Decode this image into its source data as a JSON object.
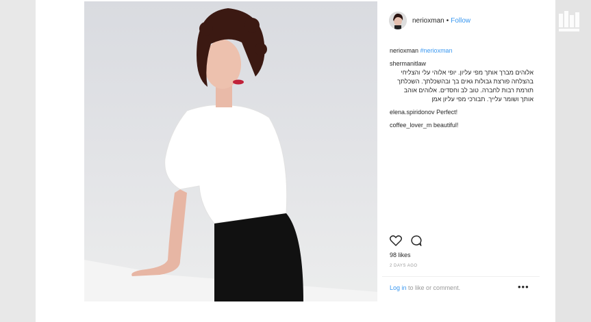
{
  "post": {
    "username": "nerioxman",
    "separator": "•",
    "follow_label": "Follow",
    "caption_user": "nerioxman",
    "caption_tag": "#nerioxman",
    "comments": [
      {
        "user": "shermanitlaw",
        "text": "אלוהים מברך אותך מפי עליון. יופי אלוהי עלי והצליחי בהצלחה פורצת גבולות גאים בך ובהשכלתך. השכלתך תורמת רבות לחברה. טוב לב וחסדים. אלוהים אוהב אותך ושומר עלייך. תבורכי מפי עליון אמן"
      },
      {
        "user": "elena.spiridonov",
        "text": "Perfect!"
      },
      {
        "user": "coffee_lover_m",
        "text": "beautiful!"
      }
    ],
    "likes": "98 likes",
    "time": "2 DAYS AGO",
    "login_link": "Log in",
    "login_rest": "to like or comment.",
    "more_label": "•••"
  },
  "icons": {
    "like": "heart-icon",
    "comment": "comment-icon",
    "more": "more-options-icon",
    "watermark": "channel-logo-icon"
  },
  "colors": {
    "link": "#3897f0",
    "text": "#262626",
    "muted": "#999999"
  }
}
